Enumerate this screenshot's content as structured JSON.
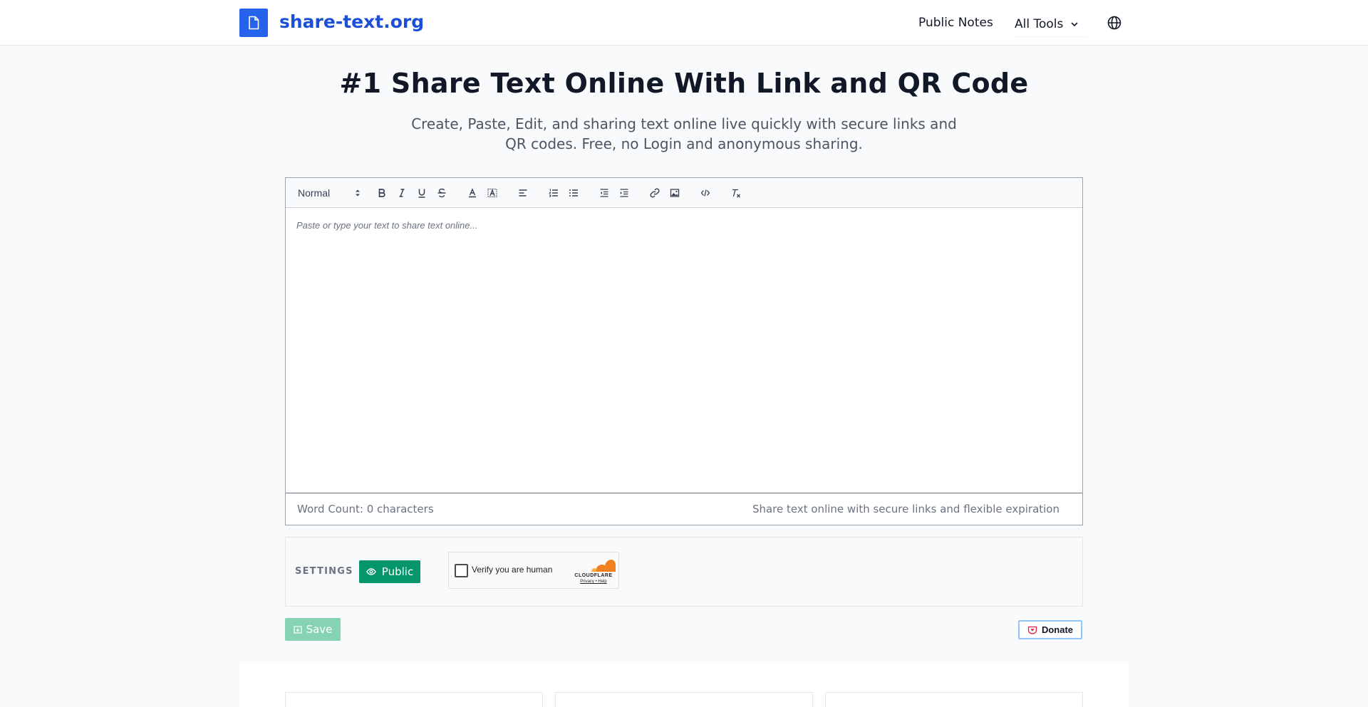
{
  "header": {
    "logo_text": "share-text.org",
    "nav": {
      "public_notes": "Public Notes",
      "all_tools": "All Tools"
    },
    "icons": {
      "logo": "document-icon",
      "dropdown": "chevron-down-icon",
      "language": "globe-icon"
    }
  },
  "hero": {
    "title": "#1 Share Text Online With Link and QR Code",
    "subtitle": "Create, Paste, Edit, and sharing text online live quickly with secure links and QR codes. Free, no Login and anonymous sharing."
  },
  "editor": {
    "format_select": "Normal",
    "toolbar_icons": [
      "bold-icon",
      "italic-icon",
      "underline-icon",
      "strikethrough-icon",
      "text-color-icon",
      "highlight-icon",
      "align-left-icon",
      "ordered-list-icon",
      "bullet-list-icon",
      "outdent-icon",
      "indent-icon",
      "link-icon",
      "image-icon",
      "code-icon",
      "clear-format-icon"
    ],
    "placeholder": "Paste or type your text to share text online...",
    "word_count": "Word Count: 0 characters",
    "footer_note": "Share text online with secure links and flexible expiration"
  },
  "settings": {
    "label": "SETTINGS",
    "visibility_button": "Public",
    "captcha": {
      "text": "Verify you are human",
      "brand": "CLOUDFLARE",
      "links": "Privacy • Help"
    }
  },
  "actions": {
    "save": "Save",
    "donate": "Donate"
  },
  "colors": {
    "brand_blue": "#2563eb",
    "public_green": "#059669",
    "save_disabled_green": "#86d3b4",
    "cloudflare_orange": "#f38020"
  }
}
